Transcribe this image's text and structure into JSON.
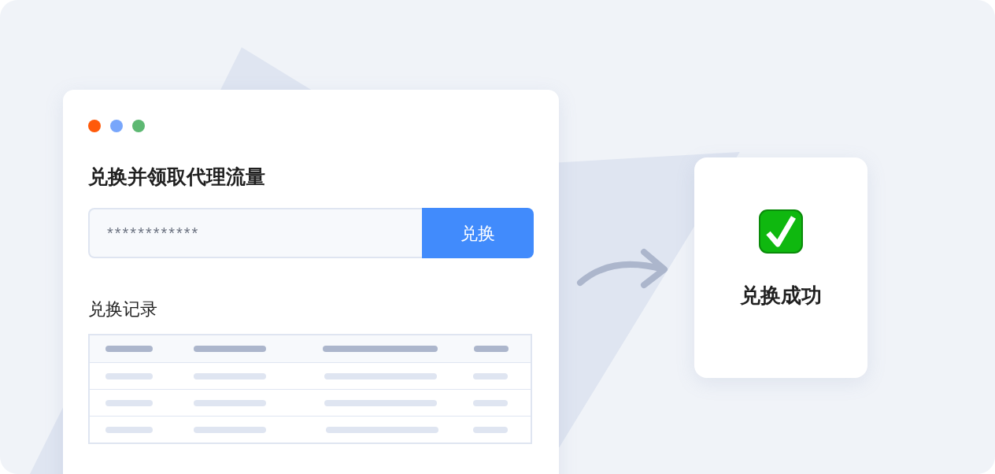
{
  "window": {
    "dots": [
      {
        "color": "#ff5a0a"
      },
      {
        "color": "#78a6fb"
      },
      {
        "color": "#5db872"
      }
    ]
  },
  "form": {
    "title": "兑换并领取代理流量",
    "code_field": {
      "placeholder": "************"
    },
    "submit_button": "兑换"
  },
  "records": {
    "heading": "兑换记录"
  },
  "result": {
    "message": "兑换成功"
  }
}
